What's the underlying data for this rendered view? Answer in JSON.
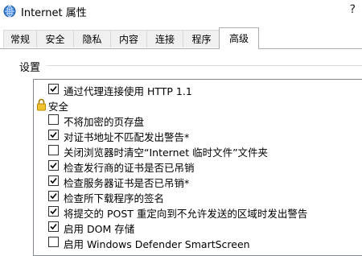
{
  "window": {
    "title": "Internet 属性",
    "help_label": "?"
  },
  "tabs": [
    {
      "label": "常规",
      "active": false
    },
    {
      "label": "安全",
      "active": false
    },
    {
      "label": "隐私",
      "active": false
    },
    {
      "label": "内容",
      "active": false
    },
    {
      "label": "连接",
      "active": false
    },
    {
      "label": "程序",
      "active": false
    },
    {
      "label": "高级",
      "active": true
    }
  ],
  "settings": {
    "group_label": "设置",
    "items": [
      {
        "type": "checkbox",
        "label": "通过代理连接使用 HTTP 1.1",
        "checked": true
      },
      {
        "type": "category",
        "label": "安全",
        "icon": "lock-icon"
      },
      {
        "type": "checkbox",
        "label": "不将加密的页存盘",
        "checked": false
      },
      {
        "type": "checkbox",
        "label": "对证书地址不匹配发出警告*",
        "checked": true
      },
      {
        "type": "checkbox",
        "label": "关闭浏览器时清空“Internet 临时文件”文件夹",
        "checked": false
      },
      {
        "type": "checkbox",
        "label": "检查发行商的证书是否已吊销",
        "checked": true
      },
      {
        "type": "checkbox",
        "label": "检查服务器证书是否已吊销*",
        "checked": true
      },
      {
        "type": "checkbox",
        "label": "检查所下载程序的签名",
        "checked": true
      },
      {
        "type": "checkbox",
        "label": "将提交的 POST 重定向到不允许发送的区域时发出警告",
        "checked": true
      },
      {
        "type": "checkbox",
        "label": "启用 DOM 存储",
        "checked": true
      },
      {
        "type": "checkbox",
        "label": "启用 Windows Defender SmartScreen",
        "checked": false
      }
    ]
  }
}
